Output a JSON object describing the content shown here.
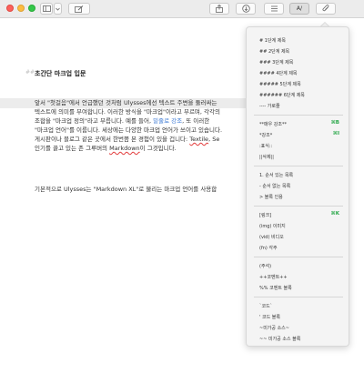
{
  "toolbar": {
    "icons": [
      "sidebar-icon",
      "chevron-down-icon",
      "compose-icon",
      "share-icon",
      "export-icon",
      "list-icon",
      "markup-icon",
      "attach-icon"
    ],
    "markup_label": "A/"
  },
  "editor": {
    "heading": "초간단 마크업 입문",
    "heading_marker": "##",
    "paragraph1": {
      "line1": "앞서 \"첫걸음\"에서 언급했던 것처럼 Ulysses에선 텍스트 주변을 둘러싸는",
      "line2": "텍스트에 의미를 부여합니다. 이러한 방식을 \"마크업\"이라고 부르며, 각각의",
      "line3_a": "조합을 \"마크업 정의\"라고 부릅니다. 예를 들어, ",
      "line3_b": "밑줄로 강조",
      "line3_c": ", 또 이러한",
      "line4": "\"마크업 언어\"를 이룹니다. 세상에는 다양한 마크업 언어가 쓰이고 있습니다.",
      "line5_a": "게시판이나 블로그 같은 곳에서 한번쯤 본 경험이 있을 겁니다: ",
      "line5_b": "Textile",
      "line5_c": ", Se",
      "line6_a": "인기를 끌고 있는 존 그루버의 ",
      "line6_b": "Markdown",
      "line6_c": "이 그것입니다."
    },
    "paragraph2": "기본적으로 Ulysses는 \"Markdown XL\"로 불리는 마크업 언어를 사용합"
  },
  "markup_menu": {
    "headings": [
      "# 1단계 제목",
      "## 2단계 제목",
      "### 3단계 제목",
      "#### 4단계 제목",
      "##### 5단계 제목",
      "###### 6단계 제목",
      "---- 가로줄"
    ],
    "emphasis": [
      {
        "label": "**매우 강조**",
        "shortcut": "⌘B"
      },
      {
        "label": "*강조*",
        "shortcut": "⌘I"
      },
      {
        "label": ":표식::",
        "shortcut": ""
      },
      {
        "label": "||삭제||",
        "shortcut": ""
      }
    ],
    "lists": [
      "1. 순서 있는 목록",
      "- 순서 없는 목록",
      "> 블록 인용"
    ],
    "links": [
      {
        "label": "[링크]",
        "shortcut": "⌘K"
      },
      {
        "label": "(img) 이미지",
        "shortcut": ""
      },
      {
        "label": "(vid) 비디오",
        "shortcut": ""
      },
      {
        "label": "(fn) 각주",
        "shortcut": ""
      }
    ],
    "comments": [
      "(주석)",
      "++코멘트++",
      "%% 코멘트 블록"
    ],
    "code": [
      "`코드`",
      "' 코드 블록",
      "~미가공 소스~",
      "~~ 미가공 소스 블록"
    ]
  }
}
